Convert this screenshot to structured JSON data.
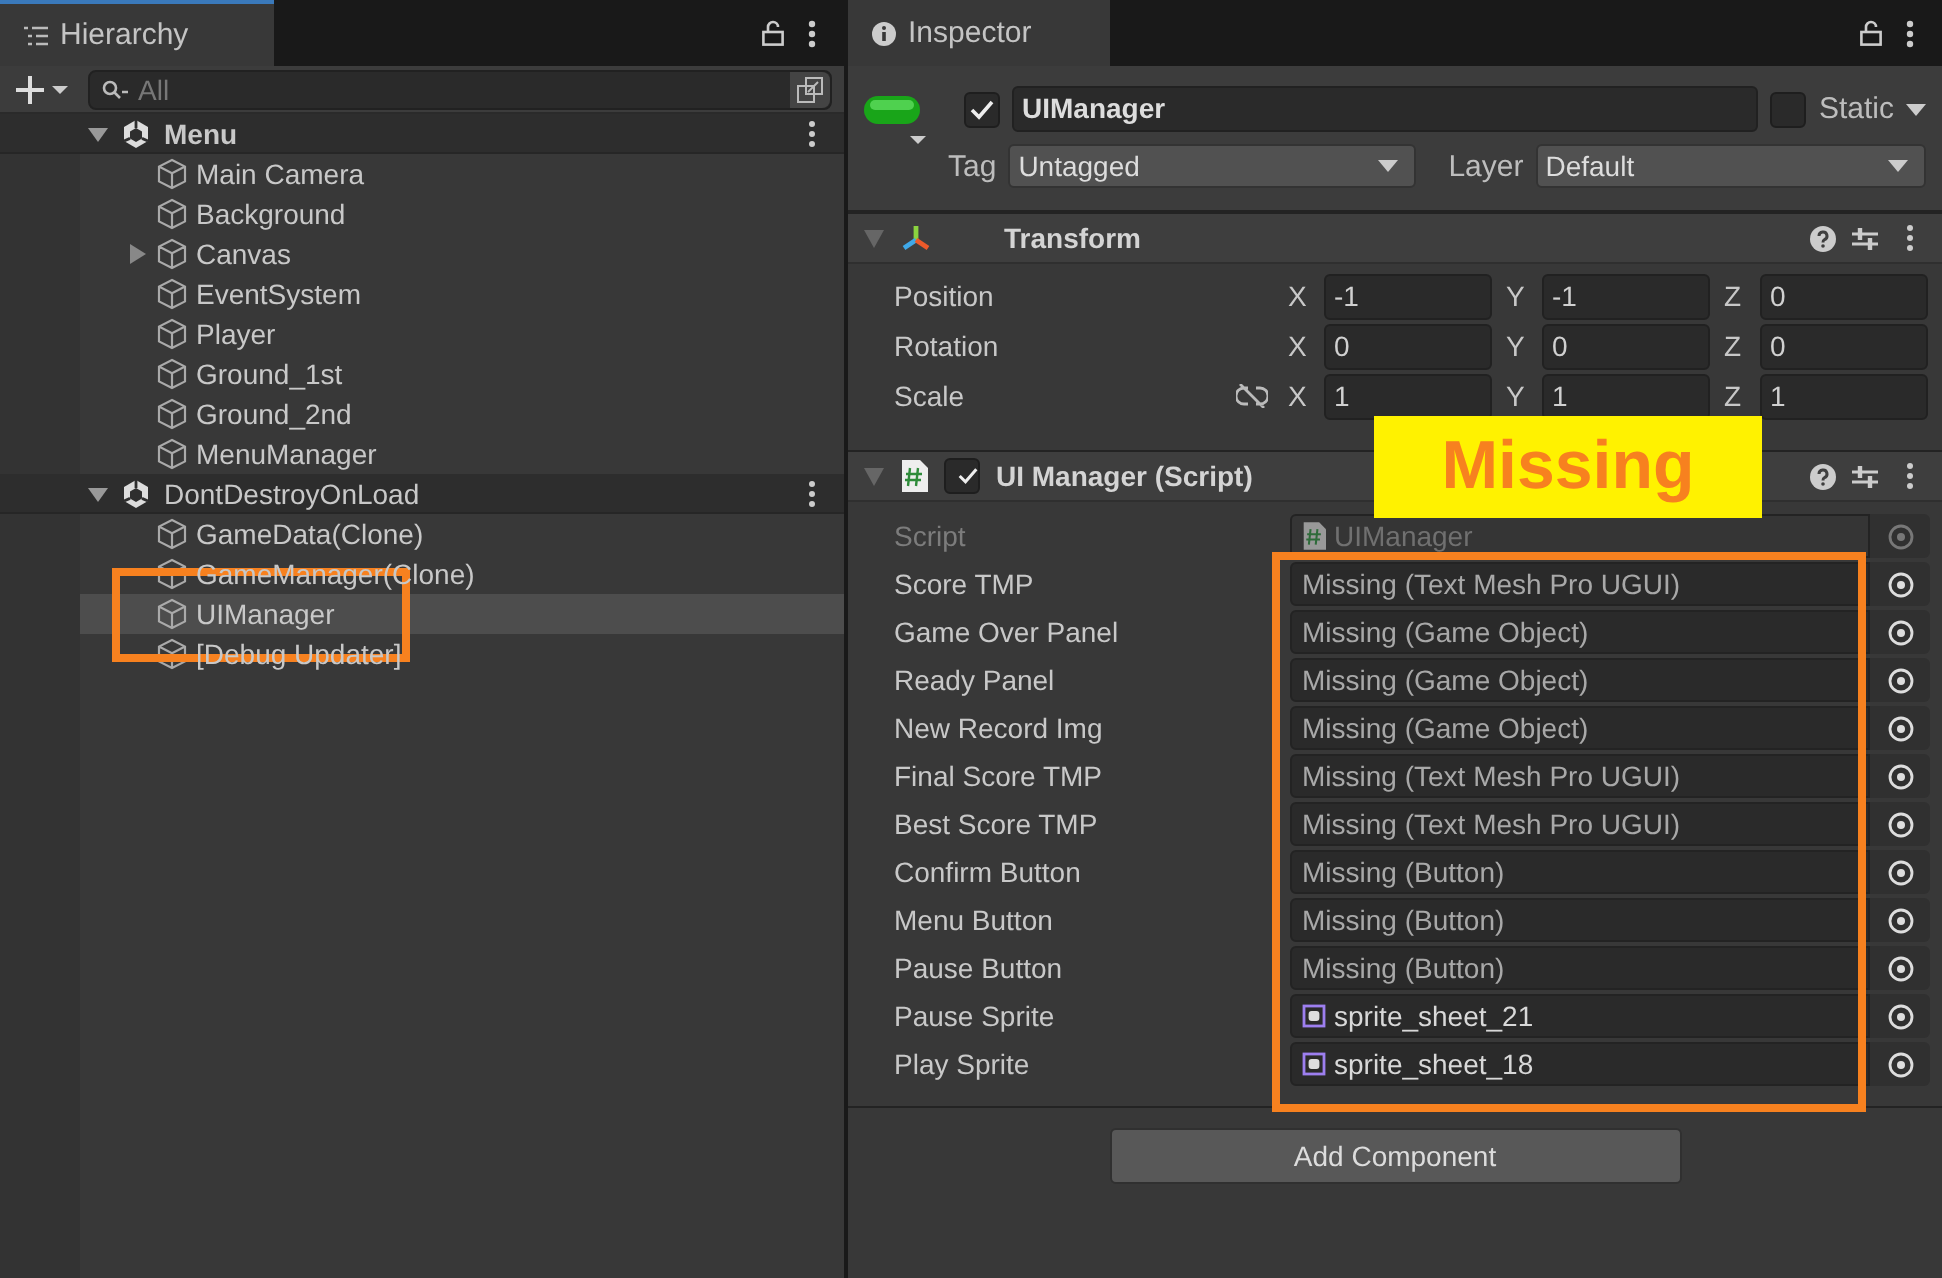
{
  "hierarchy": {
    "title": "Hierarchy",
    "search": {
      "placeholder": "All"
    },
    "scenes": [
      {
        "name": "Menu",
        "active": true,
        "expanded": true,
        "children": [
          {
            "name": "Main Camera",
            "collapsed": false,
            "selected": false
          },
          {
            "name": "Background",
            "collapsed": false,
            "selected": false
          },
          {
            "name": "Canvas",
            "collapsed": true,
            "selected": false
          },
          {
            "name": "EventSystem",
            "collapsed": false,
            "selected": false
          },
          {
            "name": "Player",
            "collapsed": false,
            "selected": false
          },
          {
            "name": "Ground_1st",
            "collapsed": false,
            "selected": false
          },
          {
            "name": "Ground_2nd",
            "collapsed": false,
            "selected": false
          },
          {
            "name": "MenuManager",
            "collapsed": false,
            "selected": false
          }
        ]
      },
      {
        "name": "DontDestroyOnLoad",
        "active": false,
        "expanded": true,
        "children": [
          {
            "name": "GameData(Clone)",
            "collapsed": false,
            "selected": false
          },
          {
            "name": "GameManager(Clone)",
            "collapsed": false,
            "selected": false
          },
          {
            "name": "UIManager",
            "collapsed": false,
            "selected": true
          },
          {
            "name": "[Debug Updater]",
            "collapsed": false,
            "selected": false
          }
        ]
      }
    ]
  },
  "inspector": {
    "title": "Inspector",
    "object": {
      "enabled": true,
      "name": "UIManager",
      "static": false,
      "static_label": "Static",
      "tag_label": "Tag",
      "tag": "Untagged",
      "layer_label": "Layer",
      "layer": "Default"
    },
    "components": [
      {
        "kind": "transform",
        "title": "Transform",
        "expanded": true,
        "rows": [
          {
            "label": "Position",
            "kind": "vector",
            "fields": [
              {
                "axis": "X",
                "value": "-1"
              },
              {
                "axis": "Y",
                "value": "-1"
              },
              {
                "axis": "Z",
                "value": "0"
              }
            ]
          },
          {
            "label": "Rotation",
            "kind": "vector",
            "fields": [
              {
                "axis": "X",
                "value": "0"
              },
              {
                "axis": "Y",
                "value": "0"
              },
              {
                "axis": "Z",
                "value": "0"
              }
            ]
          },
          {
            "label": "Scale",
            "kind": "scale",
            "fields": [
              {
                "axis": "X",
                "value": "1"
              },
              {
                "axis": "Y",
                "value": "1"
              },
              {
                "axis": "Z",
                "value": "1"
              }
            ]
          }
        ]
      },
      {
        "kind": "script",
        "title": "UI Manager (Script)",
        "enabled": true,
        "expanded": true,
        "fields": [
          {
            "label": "Script",
            "kind": "script",
            "value": "UIManager"
          },
          {
            "label": "Score TMP",
            "kind": "missing",
            "value": "Missing (Text Mesh Pro UGUI)"
          },
          {
            "label": "Game Over Panel",
            "kind": "missing",
            "value": "Missing (Game Object)"
          },
          {
            "label": "Ready Panel",
            "kind": "missing",
            "value": "Missing (Game Object)"
          },
          {
            "label": "New Record Img",
            "kind": "missing",
            "value": "Missing (Game Object)"
          },
          {
            "label": "Final Score TMP",
            "kind": "missing",
            "value": "Missing (Text Mesh Pro UGUI)"
          },
          {
            "label": "Best Score TMP",
            "kind": "missing",
            "value": "Missing (Text Mesh Pro UGUI)"
          },
          {
            "label": "Confirm Button",
            "kind": "missing",
            "value": "Missing (Button)"
          },
          {
            "label": "Menu Button",
            "kind": "missing",
            "value": "Missing (Button)"
          },
          {
            "label": "Pause Button",
            "kind": "missing",
            "value": "Missing (Button)"
          },
          {
            "label": "Pause Sprite",
            "kind": "sprite",
            "value": "sprite_sheet_21"
          },
          {
            "label": "Play Sprite",
            "kind": "sprite",
            "value": "sprite_sheet_18"
          }
        ]
      }
    ],
    "add_button": "Add Component"
  },
  "annotation": {
    "callout": "Missing"
  }
}
